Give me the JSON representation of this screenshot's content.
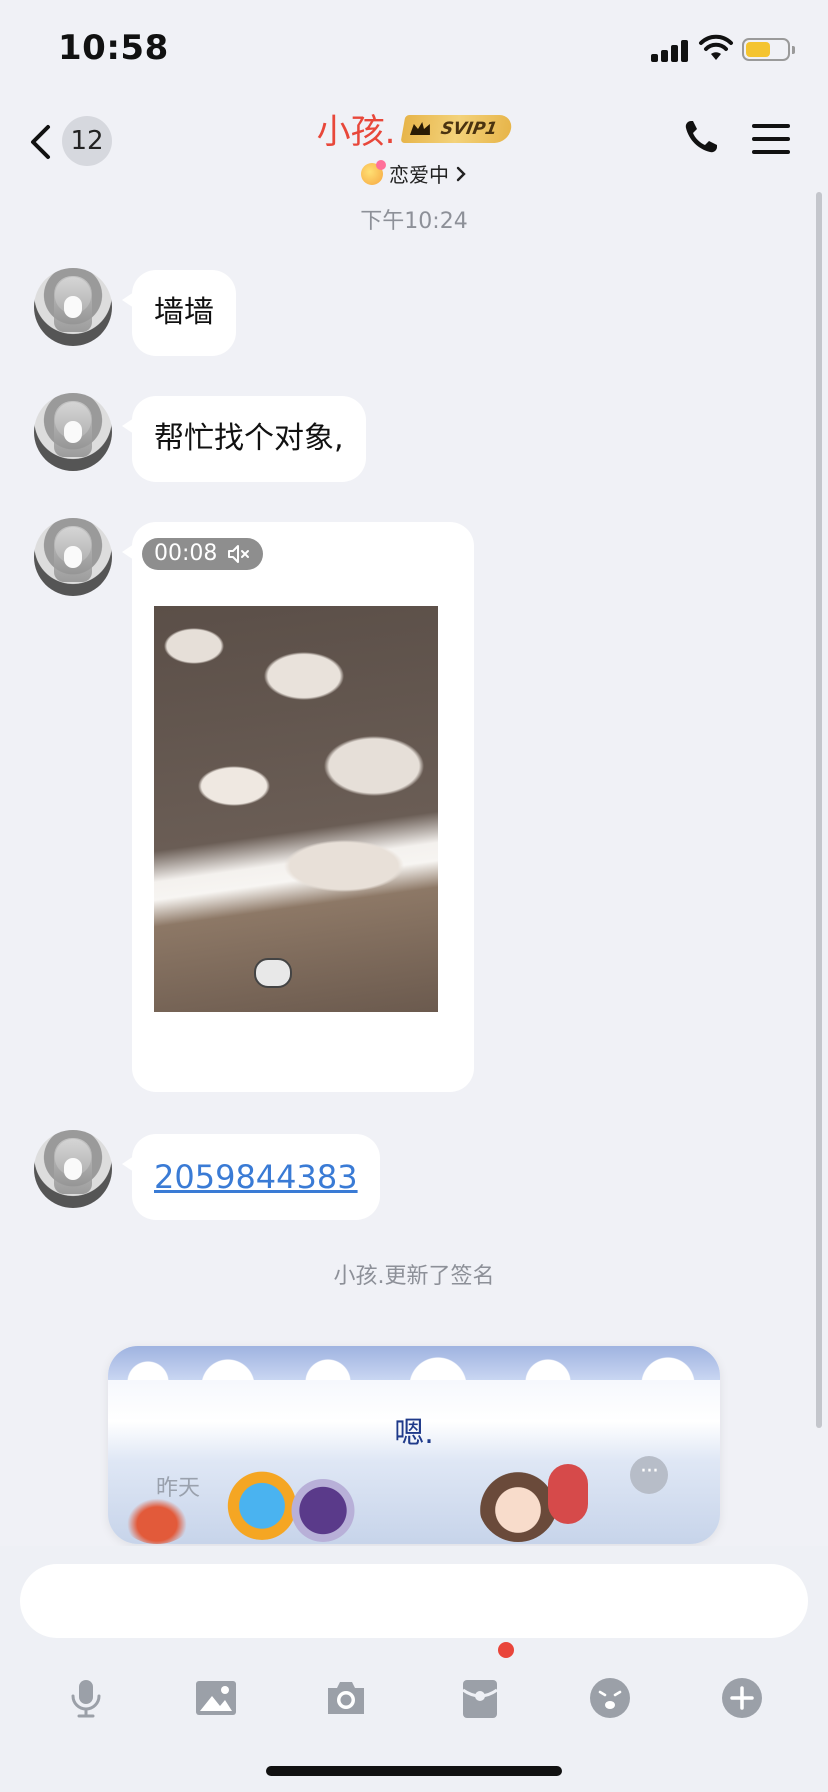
{
  "status_bar": {
    "time": "10:58"
  },
  "header": {
    "back_count": "12",
    "title": "小孩.",
    "vip_badge": "SVIP1",
    "subtitle": "恋爱中",
    "icons": [
      "chevron-left-icon",
      "phone-icon",
      "menu-icon"
    ]
  },
  "chat": {
    "timestamp": "下午10:24",
    "messages": [
      {
        "type": "text",
        "text": "墙墙"
      },
      {
        "type": "text",
        "text": "帮忙找个对象,"
      },
      {
        "type": "video",
        "duration": "00:08",
        "muted": true
      },
      {
        "type": "link",
        "text": "2059844383"
      }
    ],
    "system_notice": "小孩.更新了签名",
    "signature_card": {
      "text": "嗯.",
      "time": "昨天"
    }
  },
  "input": {
    "placeholder": ""
  },
  "toolbar": {
    "items": [
      "microphone-icon",
      "image-icon",
      "camera-icon",
      "red-packet-icon",
      "emoji-icon",
      "plus-icon"
    ],
    "red_packet_has_notification": true
  },
  "colors": {
    "title": "#e8473a",
    "link": "#3a7bd5",
    "badge_gold": "#e7b54a",
    "notification_dot": "#e9453a"
  }
}
